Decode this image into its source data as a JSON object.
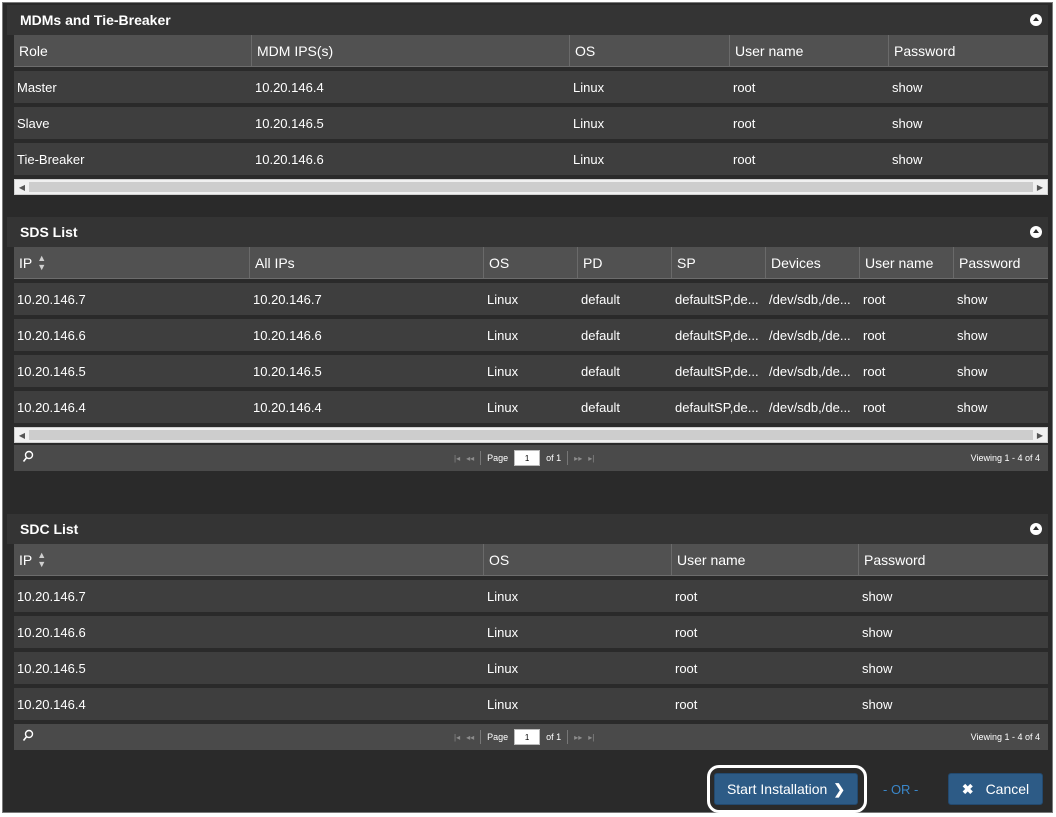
{
  "mdm": {
    "title": "MDMs and Tie-Breaker",
    "columns": [
      "Role",
      "MDM IPS(s)",
      "OS",
      "User name",
      "Password"
    ],
    "rows": [
      [
        "Master",
        "10.20.146.4",
        "Linux",
        "root",
        "show"
      ],
      [
        "Slave",
        "10.20.146.5",
        "Linux",
        "root",
        "show"
      ],
      [
        "Tie-Breaker",
        "10.20.146.6",
        "Linux",
        "root",
        "show"
      ]
    ]
  },
  "sds": {
    "title": "SDS List",
    "columns": [
      "IP",
      "All IPs",
      "OS",
      "PD",
      "SP",
      "Devices",
      "User name",
      "Password"
    ],
    "rows": [
      [
        "10.20.146.7",
        "10.20.146.7",
        "Linux",
        "default",
        "defaultSP,de...",
        "/dev/sdb,/de...",
        "root",
        "show"
      ],
      [
        "10.20.146.6",
        "10.20.146.6",
        "Linux",
        "default",
        "defaultSP,de...",
        "/dev/sdb,/de...",
        "root",
        "show"
      ],
      [
        "10.20.146.5",
        "10.20.146.5",
        "Linux",
        "default",
        "defaultSP,de...",
        "/dev/sdb,/de...",
        "root",
        "show"
      ],
      [
        "10.20.146.4",
        "10.20.146.4",
        "Linux",
        "default",
        "defaultSP,de...",
        "/dev/sdb,/de...",
        "root",
        "show"
      ]
    ],
    "pager": {
      "page_label": "Page",
      "page_value": "1",
      "of_label": "of 1",
      "viewing": "Viewing 1 - 4 of 4"
    }
  },
  "sdc": {
    "title": "SDC List",
    "columns": [
      "IP",
      "OS",
      "User name",
      "Password"
    ],
    "rows": [
      [
        "10.20.146.7",
        "Linux",
        "root",
        "show"
      ],
      [
        "10.20.146.6",
        "Linux",
        "root",
        "show"
      ],
      [
        "10.20.146.5",
        "Linux",
        "root",
        "show"
      ],
      [
        "10.20.146.4",
        "Linux",
        "root",
        "show"
      ]
    ],
    "pager": {
      "page_label": "Page",
      "page_value": "1",
      "of_label": "of 1",
      "viewing": "Viewing 1 - 4 of 4"
    }
  },
  "footer": {
    "start_label": "Start Installation",
    "or_label": "- OR -",
    "cancel_label": "Cancel"
  },
  "colors": {
    "background": "#2a2a2a",
    "header_row": "#515151",
    "data_row": "#3e3e3e",
    "button": "#2d5b86",
    "or_text": "#3a86c8"
  },
  "icons": [
    "collapse-icon",
    "sort-icon",
    "search-icon",
    "first-page-icon",
    "prev-page-icon",
    "next-page-icon",
    "last-page-icon",
    "chevron-right-icon",
    "close-icon"
  ]
}
